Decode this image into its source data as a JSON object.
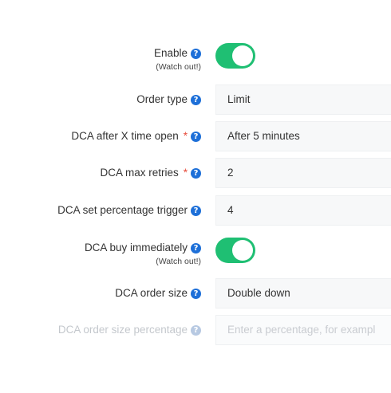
{
  "form": {
    "enable": {
      "label": "Enable",
      "note": "(Watch out!)",
      "on": true
    },
    "order_type": {
      "label": "Order type",
      "value": "Limit"
    },
    "dca_after": {
      "label": "DCA after X time open",
      "required_mark": "*",
      "value": "After 5 minutes"
    },
    "dca_max_retries": {
      "label": "DCA max retries",
      "required_mark": "*",
      "value": "2"
    },
    "dca_trigger": {
      "label": "DCA set percentage trigger",
      "value": "4"
    },
    "dca_buy_immediately": {
      "label": "DCA buy immediately",
      "note": "(Watch out!)",
      "on": true
    },
    "dca_order_size": {
      "label": "DCA order size",
      "value": "Double down"
    },
    "dca_order_size_pct": {
      "label": "DCA order size percentage",
      "placeholder": "Enter a percentage, for exampl"
    }
  },
  "icons": {
    "help": "question-circle-icon"
  },
  "colors": {
    "toggle_on": "#1fbf73",
    "help_icon": "#1d6fd8",
    "required": "#e74c3c"
  }
}
